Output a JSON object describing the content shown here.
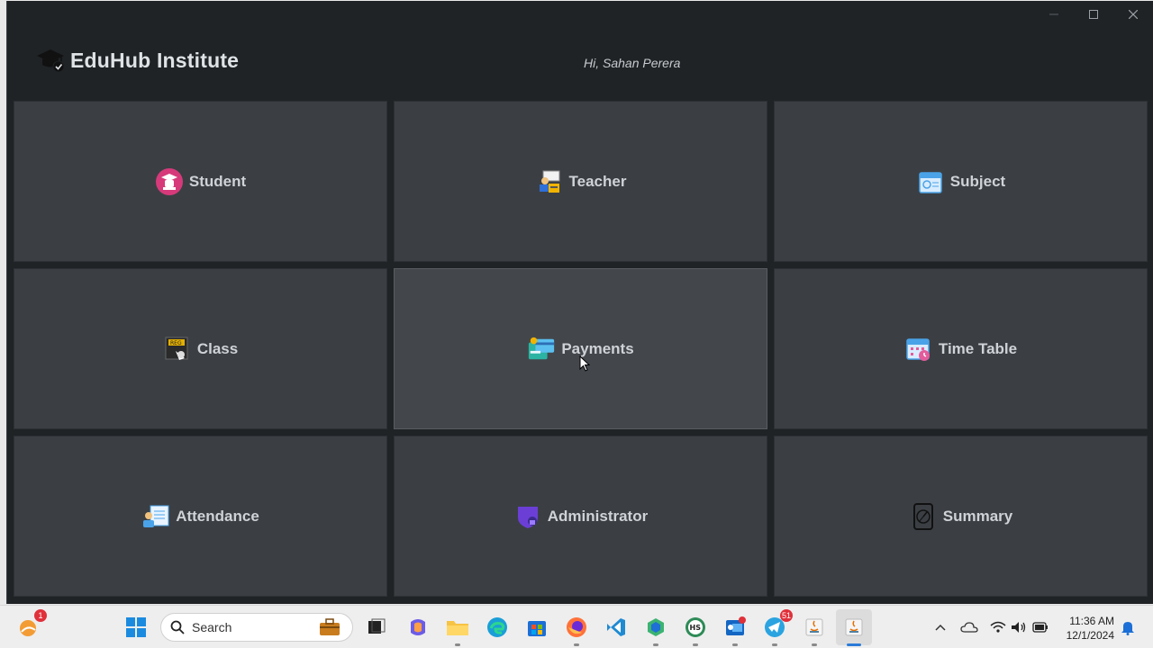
{
  "app": {
    "title": "EduHub Institute",
    "greeting": "Hi, Sahan Perera"
  },
  "tiles": [
    {
      "label": "Student",
      "icon": "student-icon"
    },
    {
      "label": "Teacher",
      "icon": "teacher-icon"
    },
    {
      "label": "Subject",
      "icon": "subject-icon"
    },
    {
      "label": "Class",
      "icon": "class-icon"
    },
    {
      "label": "Payments",
      "icon": "payments-icon"
    },
    {
      "label": "Time Table",
      "icon": "timetable-icon"
    },
    {
      "label": "Attendance",
      "icon": "attendance-icon"
    },
    {
      "label": "Administrator",
      "icon": "administrator-icon"
    },
    {
      "label": "Summary",
      "icon": "summary-icon"
    }
  ],
  "taskbar": {
    "search_placeholder": "Search",
    "notification_badge": "1",
    "outlook_badge": "",
    "telegram_badge": "51",
    "time": "11:36 AM",
    "date": "12/1/2024"
  },
  "colors": {
    "window_bg": "#1f2326",
    "tile_bg": "#3b3f44",
    "tile_text": "#cfd3d7"
  }
}
